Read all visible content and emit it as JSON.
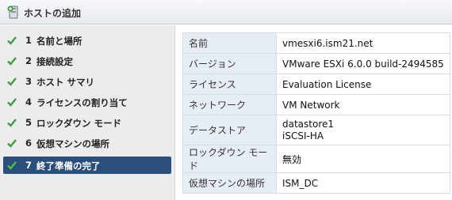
{
  "window": {
    "title": "ホストの追加",
    "icon": "add-host-icon"
  },
  "colors": {
    "accent": "#2a4f7a",
    "check": "#3f9b3f",
    "key_bg": "#e7edf4"
  },
  "steps": [
    {
      "number": "1",
      "label": "名前と場所",
      "completed": true,
      "selected": false
    },
    {
      "number": "2",
      "label": "接続設定",
      "completed": true,
      "selected": false
    },
    {
      "number": "3",
      "label": "ホスト サマリ",
      "completed": true,
      "selected": false
    },
    {
      "number": "4",
      "label": "ライセンスの割り当て",
      "completed": true,
      "selected": false
    },
    {
      "number": "5",
      "label": "ロックダウン モード",
      "completed": true,
      "selected": false
    },
    {
      "number": "6",
      "label": "仮想マシンの場所",
      "completed": true,
      "selected": false
    },
    {
      "number": "7",
      "label": "終了準備の完了",
      "completed": true,
      "selected": true
    }
  ],
  "summary": [
    {
      "key": "名前",
      "value": "vmesxi6.ism21.net"
    },
    {
      "key": "バージョン",
      "value": "VMware ESXi 6.0.0 build-2494585"
    },
    {
      "key": "ライセンス",
      "value": "Evaluation License"
    },
    {
      "key": "ネットワーク",
      "value": "VM Network"
    },
    {
      "key": "データストア",
      "values": [
        "datastore1",
        "iSCSI-HA"
      ]
    },
    {
      "key": "ロックダウン モード",
      "value": "無効"
    },
    {
      "key": "仮想マシンの場所",
      "value": "ISM_DC"
    }
  ]
}
